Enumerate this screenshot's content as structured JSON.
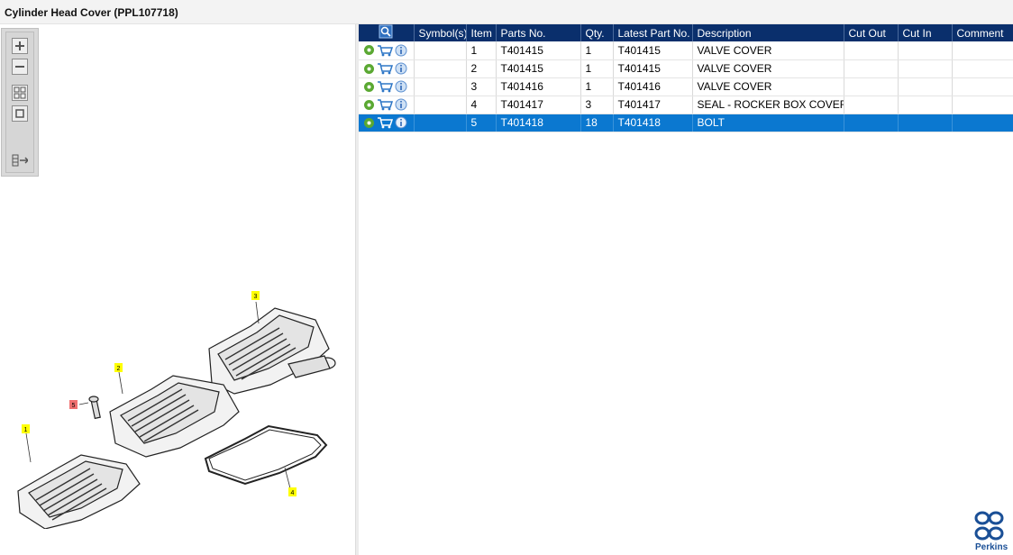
{
  "window": {
    "title": "Cylinder Head Cover (PPL107718)"
  },
  "viewer": {
    "tools": [
      {
        "name": "zoom-in-icon"
      },
      {
        "name": "zoom-out-icon"
      },
      {
        "name": "fit-view-icon"
      },
      {
        "name": "actual-size-icon"
      },
      {
        "name": "export-icon"
      }
    ],
    "callouts": [
      "1",
      "2",
      "3",
      "4",
      "5"
    ]
  },
  "parts_table": {
    "columns": [
      "",
      "Symbol(s)",
      "Item",
      "Parts No.",
      "Qty.",
      "Latest Part No.",
      "Description",
      "Cut Out",
      "Cut In",
      "Comment"
    ],
    "rows": [
      {
        "item": "1",
        "part_no": "T401415",
        "qty": "1",
        "latest": "T401415",
        "description": "VALVE COVER",
        "cut_out": "",
        "cut_in": "",
        "comment": "",
        "symbols": ""
      },
      {
        "item": "2",
        "part_no": "T401415",
        "qty": "1",
        "latest": "T401415",
        "description": "VALVE COVER",
        "cut_out": "",
        "cut_in": "",
        "comment": "",
        "symbols": ""
      },
      {
        "item": "3",
        "part_no": "T401416",
        "qty": "1",
        "latest": "T401416",
        "description": "VALVE COVER",
        "cut_out": "",
        "cut_in": "",
        "comment": "",
        "symbols": ""
      },
      {
        "item": "4",
        "part_no": "T401417",
        "qty": "3",
        "latest": "T401417",
        "description": "SEAL - ROCKER BOX COVER",
        "cut_out": "",
        "cut_in": "",
        "comment": "",
        "symbols": ""
      },
      {
        "item": "5",
        "part_no": "T401418",
        "qty": "18",
        "latest": "T401418",
        "description": "BOLT",
        "cut_out": "",
        "cut_in": "",
        "comment": "",
        "symbols": ""
      }
    ],
    "selected_row": 4
  },
  "brand": {
    "name": "Perkins",
    "color": "#1a4f96"
  },
  "colors": {
    "header": "#0a2f6c",
    "selection": "#0b78d0",
    "gear": "#5aa832",
    "callout": "#ffff00",
    "callout_selected": "#f07070"
  }
}
